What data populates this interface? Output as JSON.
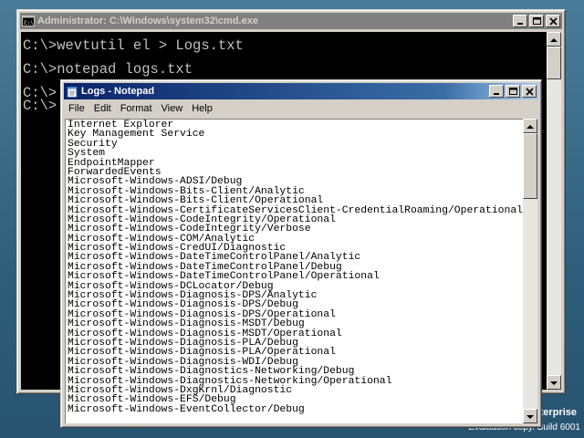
{
  "desktop": {
    "edition": "Enterprise",
    "build": "Evaluation copy. Build 6001"
  },
  "cmd": {
    "title": "Administrator: C:\\Windows\\system32\\cmd.exe",
    "lines": [
      "C:\\>wevtutil el > Logs.txt",
      "C:\\>notepad logs.txt",
      "C:\\>",
      "C:\\>"
    ]
  },
  "notepad": {
    "title": "Logs - Notepad",
    "menu": [
      "File",
      "Edit",
      "Format",
      "View",
      "Help"
    ],
    "lines": [
      "Internet Explorer",
      "Key Management Service",
      "Security",
      "System",
      "EndpointMapper",
      "ForwardedEvents",
      "Microsoft-Windows-ADSI/Debug",
      "Microsoft-Windows-Bits-Client/Analytic",
      "Microsoft-Windows-Bits-Client/Operational",
      "Microsoft-Windows-CertificateServicesClient-CredentialRoaming/Operational",
      "Microsoft-Windows-CodeIntegrity/Operational",
      "Microsoft-Windows-CodeIntegrity/Verbose",
      "Microsoft-Windows-COM/Analytic",
      "Microsoft-Windows-CredUI/Diagnostic",
      "Microsoft-Windows-DateTimeControlPanel/Analytic",
      "Microsoft-Windows-DateTimeControlPanel/Debug",
      "Microsoft-Windows-DateTimeControlPanel/Operational",
      "Microsoft-Windows-DCLocator/Debug",
      "Microsoft-Windows-Diagnosis-DPS/Analytic",
      "Microsoft-Windows-Diagnosis-DPS/Debug",
      "Microsoft-Windows-Diagnosis-DPS/Operational",
      "Microsoft-Windows-Diagnosis-MSDT/Debug",
      "Microsoft-Windows-Diagnosis-MSDT/Operational",
      "Microsoft-Windows-Diagnosis-PLA/Debug",
      "Microsoft-Windows-Diagnosis-PLA/Operational",
      "Microsoft-Windows-Diagnosis-WDI/Debug",
      "Microsoft-Windows-Diagnostics-Networking/Debug",
      "Microsoft-Windows-Diagnostics-Networking/Operational",
      "Microsoft-Windows-DxgKrnl/Diagnostic",
      "Microsoft-Windows-EFS/Debug",
      "Microsoft-Windows-EventCollector/Debug"
    ]
  }
}
